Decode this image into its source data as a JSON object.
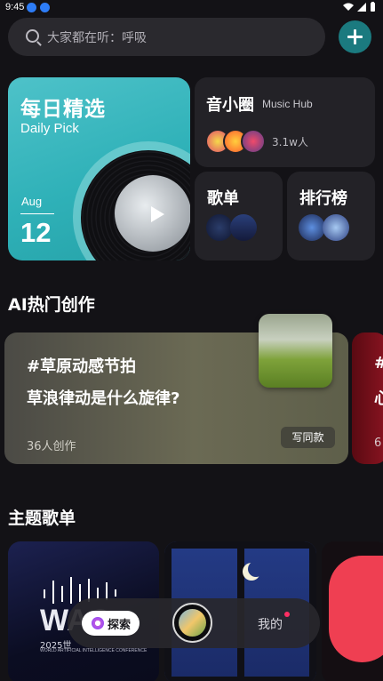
{
  "status_bar": {
    "time": "9:45"
  },
  "search": {
    "placeholder": "大家都在听：呼吸"
  },
  "daily_pick": {
    "title_cn": "每日精选",
    "title_en": "Daily Pick",
    "month": "Aug",
    "day": "12"
  },
  "music_hub": {
    "title": "音小圈",
    "subtitle": "Music Hub",
    "count": "3.1w人"
  },
  "playlist_tile": {
    "title": "歌单"
  },
  "ranking_tile": {
    "title": "排行榜"
  },
  "ai_section": {
    "title": "AI热门创作",
    "cards": [
      {
        "tag": "#草原动感节拍",
        "question": "草浪律动是什么旋律?",
        "creators": "36人创作",
        "write_label": "写同款"
      },
      {
        "tag": "#",
        "question": "心",
        "creators": "6"
      }
    ]
  },
  "theme_section": {
    "title": "主题歌单",
    "cards": [
      {
        "logo": "WAC",
        "year_line": "2025世",
        "sub_line": "WORLD ARTIFICIAL INTELLIGENCE CONFERENCE"
      }
    ]
  },
  "bottom_nav": {
    "explore_label": "探索",
    "mine_label": "我的"
  },
  "colors": {
    "accent": "#1b7a7f",
    "daily_bg": "#2fb1b8",
    "card_bg": "#232227",
    "page_bg": "#131216",
    "badge": "#ff2e63"
  }
}
